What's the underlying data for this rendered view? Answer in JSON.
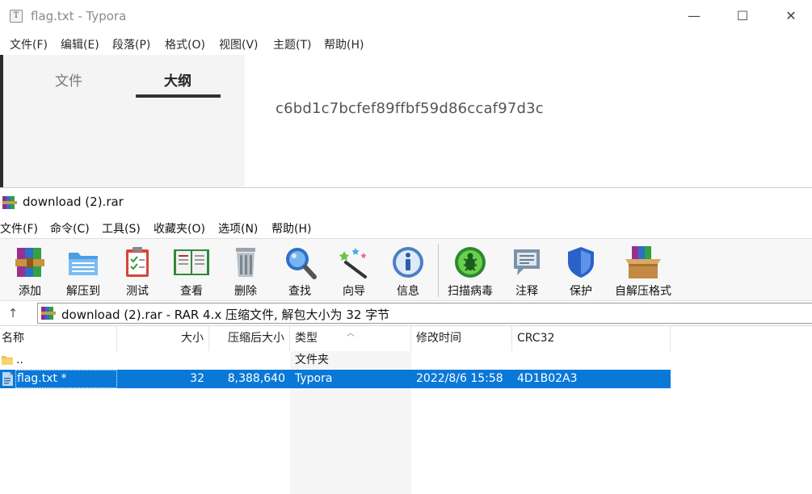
{
  "typora": {
    "title": "flag.txt - Typora",
    "app_icon_letter": "T",
    "window_controls": {
      "minimize": "—",
      "maximize": "☐",
      "close": "✕"
    },
    "menu": [
      "文件(F)",
      "编辑(E)",
      "段落(P)",
      "格式(O)",
      "视图(V)",
      "主题(T)",
      "帮助(H)"
    ],
    "sidebar_tabs": {
      "files": "文件",
      "outline": "大纲",
      "active": "outline"
    },
    "content_text": "c6bd1c7bcfef89ffbf59d86ccaf97d3c"
  },
  "winrar": {
    "title": "download (2).rar",
    "menu": [
      "文件(F)",
      "命令(C)",
      "工具(S)",
      "收藏夹(O)",
      "选项(N)",
      "帮助(H)"
    ],
    "toolbar": [
      {
        "label": "添加",
        "icon": "add-archive-icon"
      },
      {
        "label": "解压到",
        "icon": "extract-to-icon"
      },
      {
        "label": "测试",
        "icon": "test-clipboard-icon"
      },
      {
        "label": "查看",
        "icon": "view-book-icon"
      },
      {
        "label": "删除",
        "icon": "trash-icon"
      },
      {
        "label": "查找",
        "icon": "magnifier-icon"
      },
      {
        "label": "向导",
        "icon": "wizard-wand-icon"
      },
      {
        "label": "信息",
        "icon": "info-icon"
      },
      {
        "label": "扫描病毒",
        "icon": "virus-scan-icon"
      },
      {
        "label": "注释",
        "icon": "comment-icon"
      },
      {
        "label": "保护",
        "icon": "shield-icon"
      },
      {
        "label": "自解压格式",
        "icon": "sfx-box-icon"
      }
    ],
    "address": "download (2).rar - RAR 4.x 压缩文件, 解包大小为 32 字节",
    "columns": {
      "name": "名称",
      "size": "大小",
      "packed": "压缩后大小",
      "type": "类型",
      "modified": "修改时间",
      "crc": "CRC32"
    },
    "rows": [
      {
        "name": "..",
        "size": "",
        "packed": "",
        "type": "文件夹",
        "modified": "",
        "crc": "",
        "icon": "folder-icon",
        "selected": false
      },
      {
        "name": "flag.txt *",
        "size": "32",
        "packed": "8,388,640",
        "type": "Typora",
        "modified": "2022/8/6 15:58",
        "crc": "4D1B02A3",
        "icon": "text-file-icon",
        "selected": true
      }
    ],
    "colors": {
      "selection": "#0a78d7"
    }
  }
}
